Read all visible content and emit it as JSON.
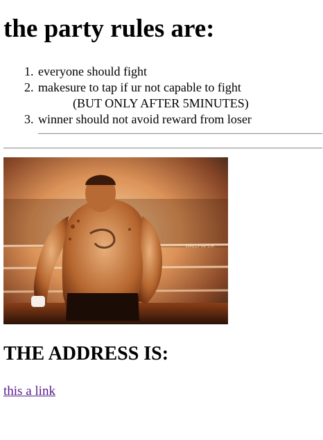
{
  "heading": "the party rules are:",
  "rules": [
    {
      "number": "1.",
      "text": "everyone should fight"
    },
    {
      "number": "2.",
      "text": "makesure to tap if ur not capable to fight",
      "note": "(BUT ONLY AFTER 5MINUTES)"
    },
    {
      "number": "3.",
      "text": "winner should not avoid reward from loser"
    }
  ],
  "photo": {
    "icon": "fighter-photo",
    "watermark": "WALLPAPER"
  },
  "address_heading": "THE ADDRESS IS:",
  "link_text": "this a link",
  "colors": {
    "link": "#551a8b",
    "rule_line": "#9a9a9a",
    "photo_warm": "#d98a4a",
    "photo_dark": "#2a1208"
  }
}
